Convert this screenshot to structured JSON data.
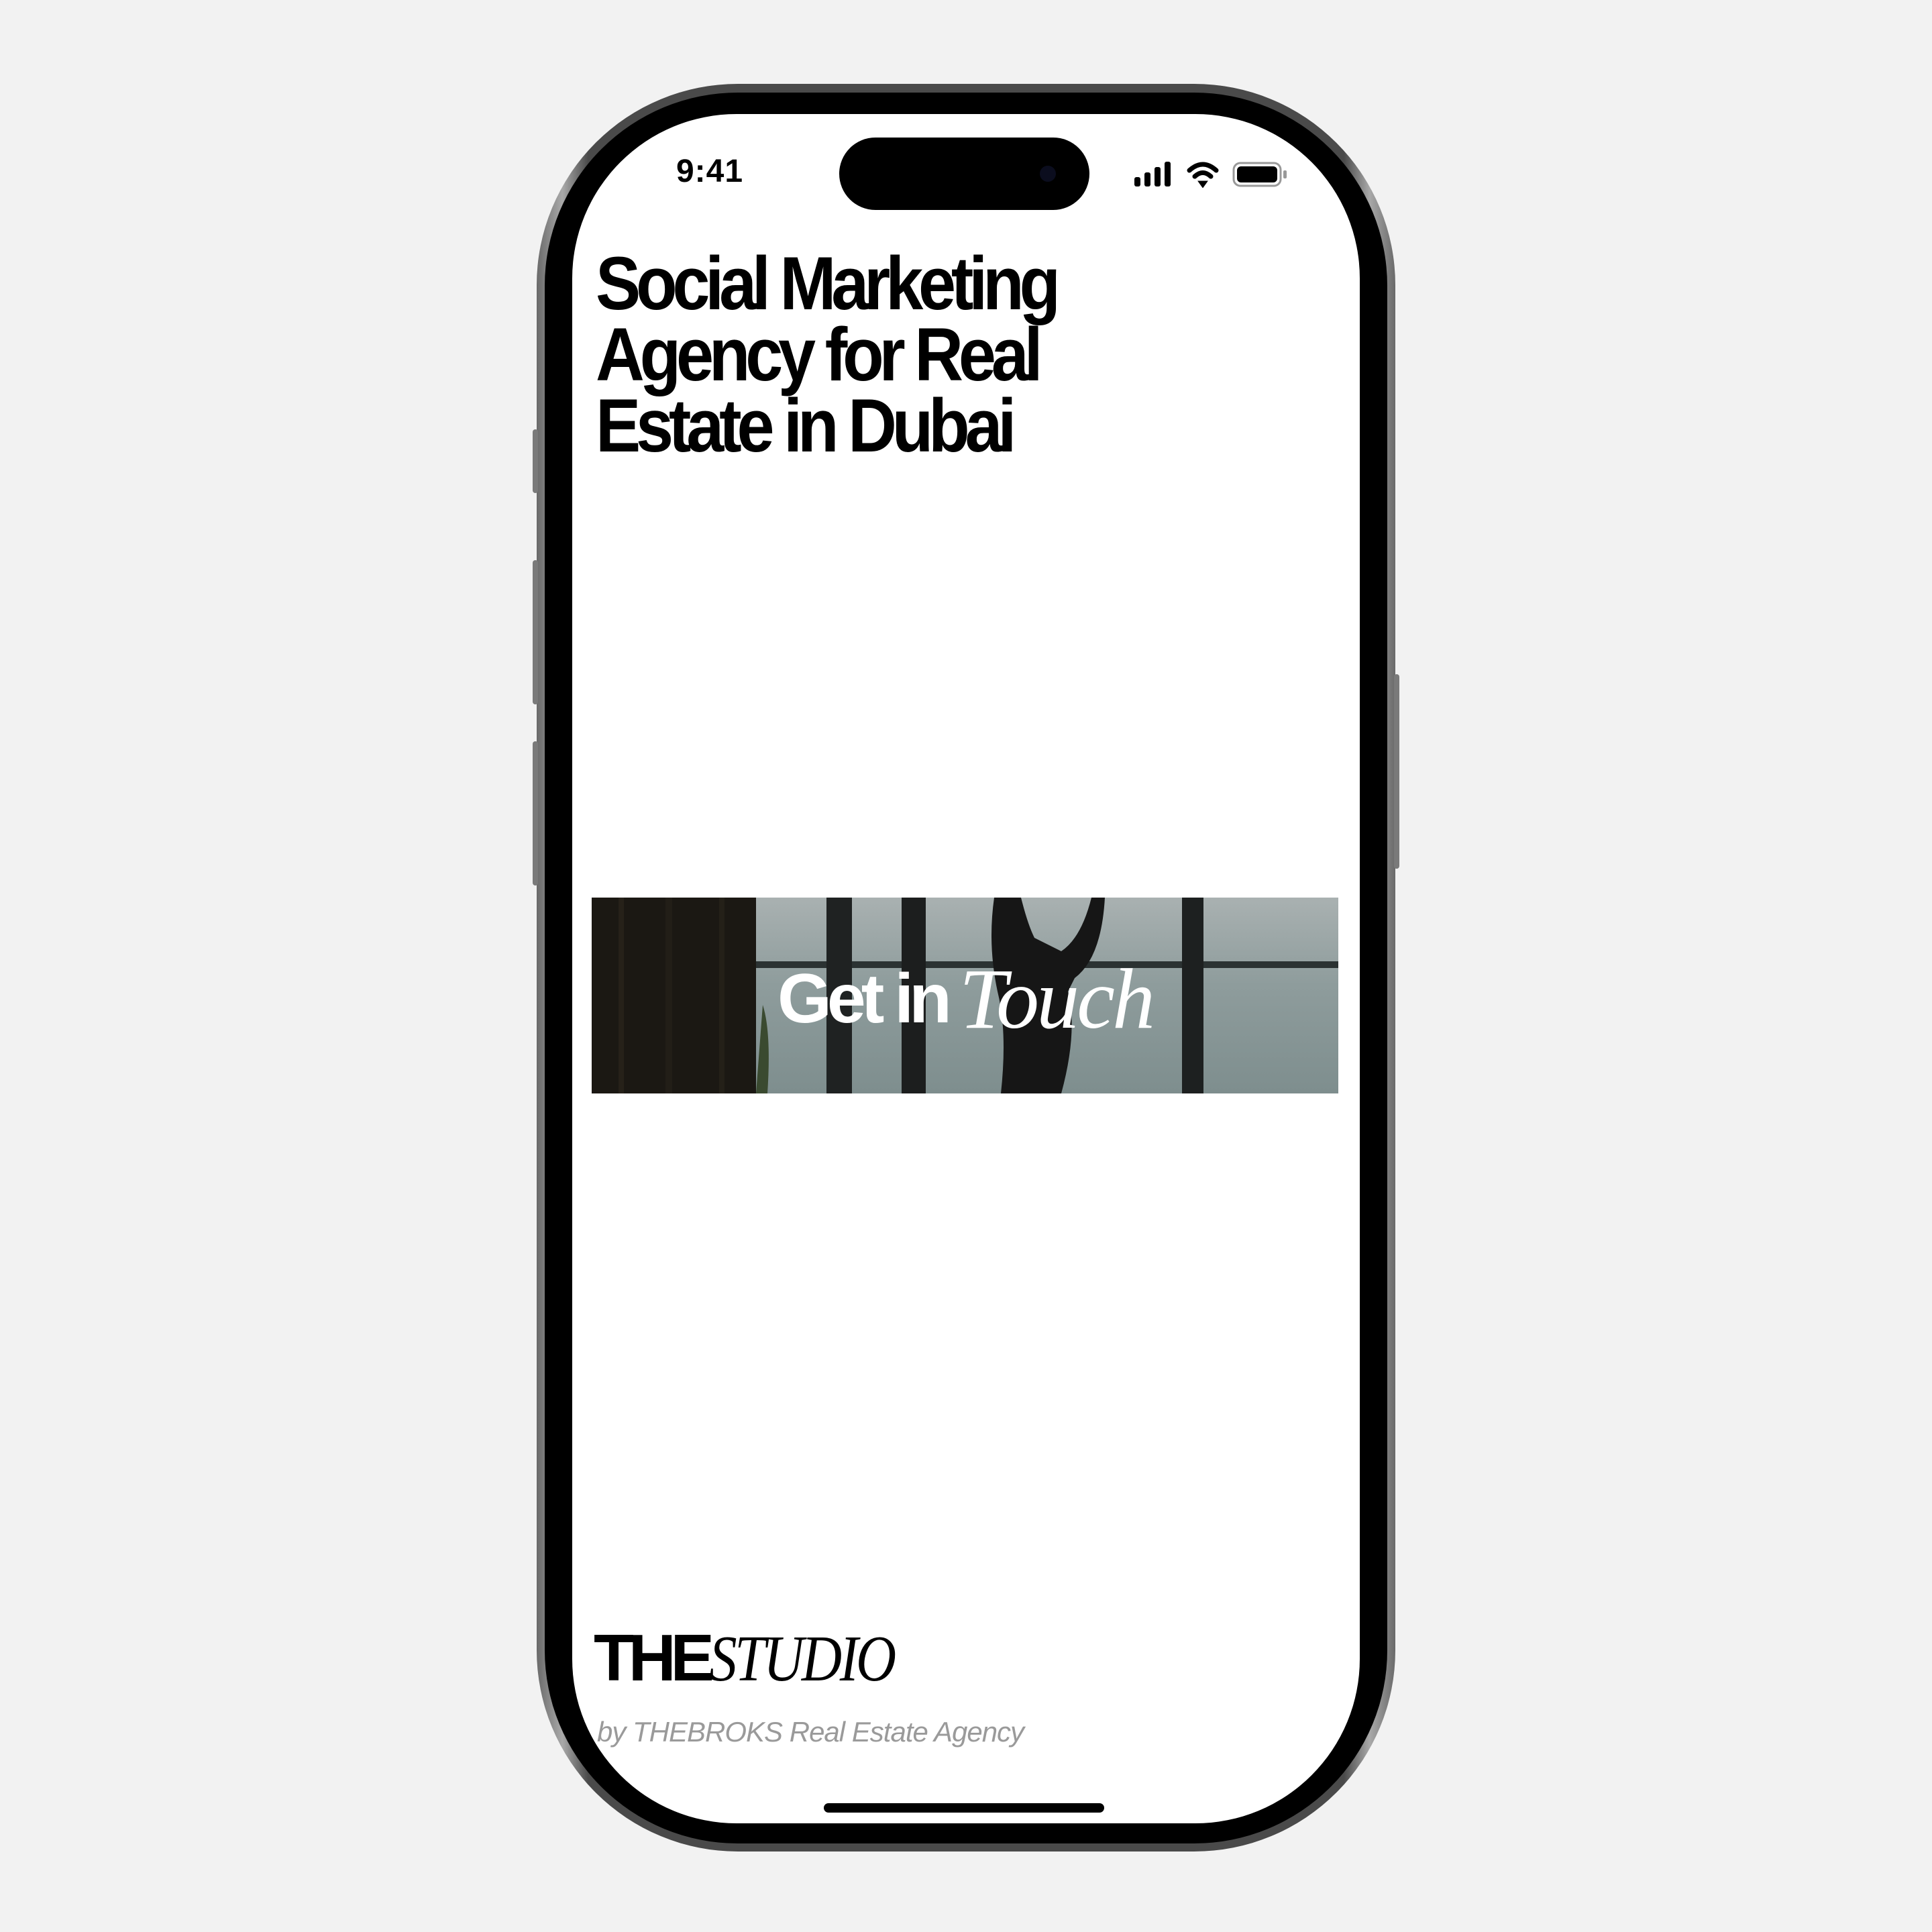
{
  "status_bar": {
    "time": "9:41",
    "icons": [
      "cellular-signal-icon",
      "wifi-icon",
      "battery-icon"
    ]
  },
  "hero": {
    "heading_lines": [
      "Social Marketing",
      "Agency for Real",
      "Estate in Dubai"
    ]
  },
  "cta_banner": {
    "label_regular": "Get in",
    "label_italic": "Touch"
  },
  "footer": {
    "logo_bold": "THE",
    "logo_italic": "STUDIO",
    "byline": "by THEBROKS Real Estate Agency"
  },
  "colors": {
    "background": "#f2f2f2",
    "text": "#000000",
    "byline": "#9a9a9a",
    "screen": "#ffffff"
  }
}
